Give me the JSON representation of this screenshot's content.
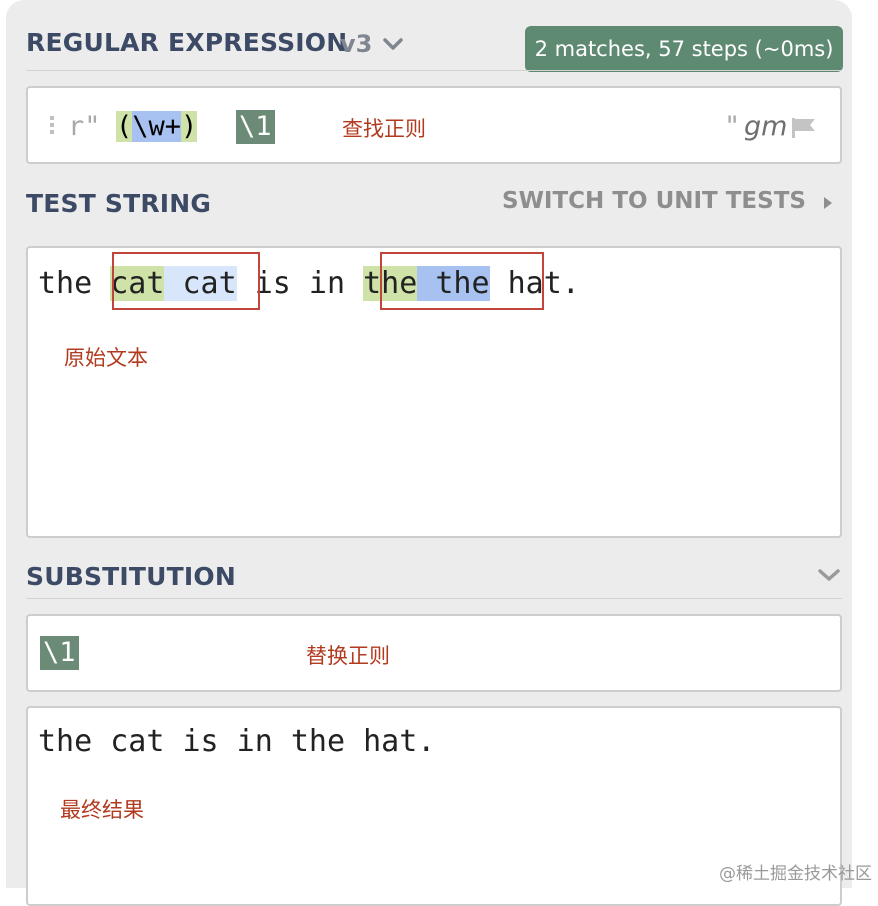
{
  "regex_section": {
    "title": "REGULAR EXPRESSION",
    "version": "v3",
    "status": "2 matches, 57 steps (~0ms)",
    "delimiter_open": "r\"",
    "pattern_group": "(\\w+)",
    "paren_open": "(",
    "group_body": "\\w+",
    "paren_close": ")",
    "backref": "\\1",
    "annotation": "查找正则",
    "delimiter_close": "\"",
    "flags": "gm"
  },
  "test_section": {
    "title": "TEST STRING",
    "switch_label": "SWITCH TO UNIT TESTS",
    "text": "the cat cat is in the the hat.",
    "segments": [
      {
        "text": "the ",
        "style": "plain"
      },
      {
        "text": "cat",
        "style": "group"
      },
      {
        "text": " cat",
        "style": "match"
      },
      {
        "text": " is in ",
        "style": "plain"
      },
      {
        "text": "the",
        "style": "group"
      },
      {
        "text": " the",
        "style": "match-alt"
      },
      {
        "text": " hat.",
        "style": "plain"
      }
    ],
    "annotation": "原始文本"
  },
  "substitution_section": {
    "title": "SUBSTITUTION",
    "value": "\\1",
    "annotation": "替换正则",
    "result": "the cat is in the hat.",
    "result_annotation": "最终结果"
  },
  "watermark": "@稀土掘金技术社区",
  "colors": {
    "section_title": "#3c4a66",
    "badge_bg": "#5f8a72",
    "group_highlight": "#cfe2a8",
    "match_highlight": "#d8e6fb",
    "match_highlight_alt": "#a7c1f0",
    "annotation": "#b23b1f",
    "match_outline": "#c0453a"
  }
}
